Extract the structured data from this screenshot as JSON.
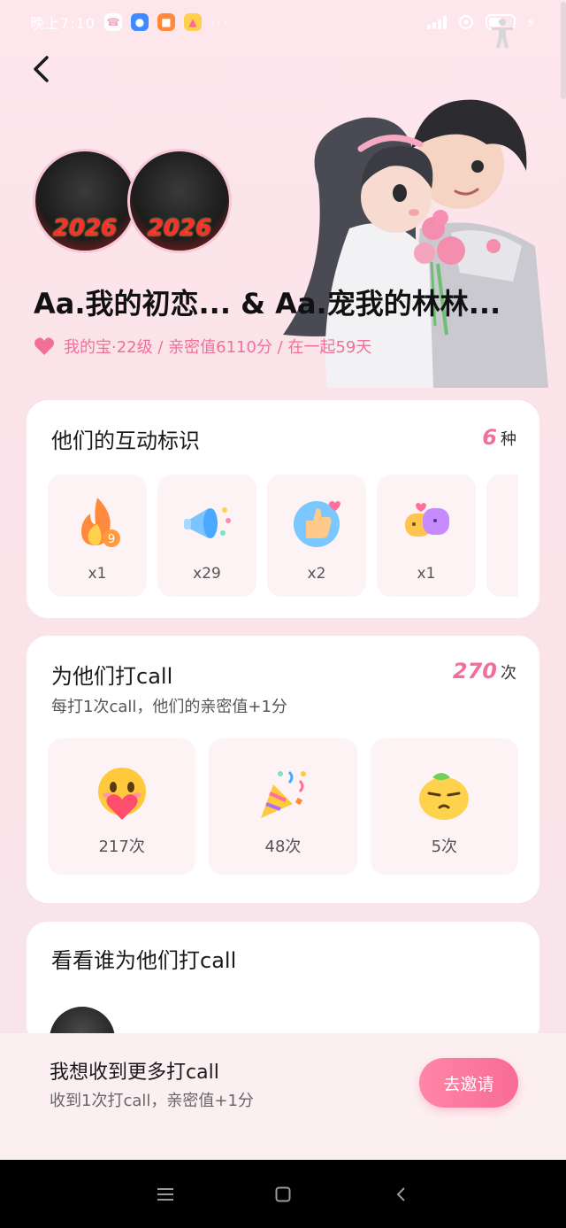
{
  "status_bar": {
    "time": "晚上7:10",
    "more": "···"
  },
  "hero": {
    "avatar_1_frame_text": "2026",
    "avatar_2_frame_text": "2026",
    "title": "Aa.我的初恋... & Aa.宠我的林林...",
    "meta": "我的宝·22级 / 亲密值6110分 / 在一起59天"
  },
  "badges_card": {
    "title": "他们的互动标识",
    "count_num": "6",
    "count_unit": "种",
    "badges": [
      {
        "icon": "fire-badge-icon",
        "count": "x1"
      },
      {
        "icon": "megaphone-badge-icon",
        "count": "x29"
      },
      {
        "icon": "thumbs-up-badge-icon",
        "count": "x2"
      },
      {
        "icon": "chat-hearts-badge-icon",
        "count": "x1"
      }
    ]
  },
  "call_card": {
    "title": "为他们打call",
    "count_num": "270",
    "count_unit": "次",
    "subtitle": "每打1次call，他们的亲密值+1分",
    "items": [
      {
        "icon": "heart-hug-emoji-icon",
        "count": "217次"
      },
      {
        "icon": "party-popper-emoji-icon",
        "count": "48次"
      },
      {
        "icon": "sour-lemon-emoji-icon",
        "count": "5次"
      }
    ]
  },
  "supporters_card": {
    "title": "看看谁为他们打call"
  },
  "invite": {
    "title": "我想收到更多打call",
    "subtitle": "收到1次打call，亲密值+1分",
    "button": "去邀请"
  },
  "colors": {
    "accent": "#f0709a",
    "button_start": "#ff86a6",
    "button_end": "#f86b96",
    "background": "#fbe3ea"
  }
}
